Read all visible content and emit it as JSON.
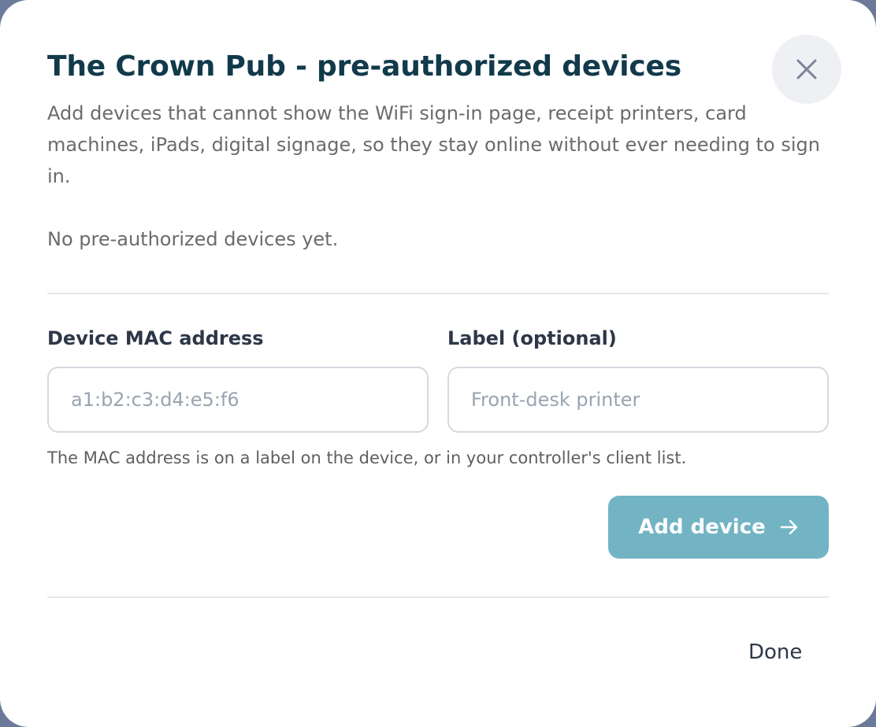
{
  "dialog": {
    "title": "The Crown Pub - pre-authorized devices",
    "description": "Add devices that cannot show the WiFi sign-in page, receipt printers, card machines, iPads, digital signage, so they stay online without ever needing to sign in.",
    "empty_state": "No pre-authorized devices yet.",
    "close_icon": "close-icon"
  },
  "form": {
    "mac": {
      "label": "Device MAC address",
      "placeholder": "a1:b2:c3:d4:e5:f6",
      "value": ""
    },
    "label_field": {
      "label": "Label (optional)",
      "placeholder": "Front-desk printer",
      "value": ""
    },
    "hint": "The MAC address is on a label on the device, or in your controller's client list.",
    "add_button_label": "Add device",
    "add_button_icon": "arrow-right-icon"
  },
  "footer": {
    "done_label": "Done"
  },
  "colors": {
    "title": "#113a4b",
    "accent_button": "#72b4c4",
    "close_button_bg": "#eef0f4"
  }
}
